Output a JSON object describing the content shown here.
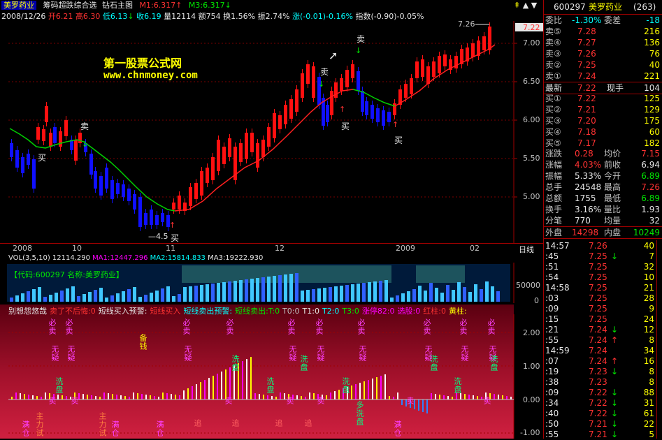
{
  "header": {
    "stock_name": "美罗药业",
    "formula": "筹码超跌综合选",
    "indicator": "钻石主图",
    "m1": "M1:6.317",
    "m3": "M3:6.317",
    "date": "2008/12/26",
    "open": "开6.21",
    "high": "高6.30",
    "low": "低6.13",
    "close": "收6.19",
    "volume": "量12114",
    "amount": "额754",
    "turnover": "换1.56%",
    "amplitude": "振2.74%",
    "change": "涨(-0.01)-0.16%",
    "index": "指数(-0.90)-0.05%",
    "watermark_title": "第一股票公式网",
    "watermark_url": "www.chnmoney.com"
  },
  "price_axis": {
    "labels": [
      "7.00",
      "6.50",
      "6.00",
      "5.50",
      "5.00"
    ],
    "current": "7.22",
    "top": "7.26"
  },
  "date_axis": {
    "labels": [
      "2008",
      "10",
      "11",
      "12",
      "2009",
      "02"
    ],
    "mode": "日线"
  },
  "price_marks": {
    "buy": "买",
    "sell": "卖",
    "low_note": "4.5"
  },
  "volume": {
    "header": "VOL(3,5,10) 12114.290",
    "ma1": "MA1:12447.296",
    "ma2": "MA2:15814.833",
    "ma3": "MA3:19222.930",
    "box": "【代码:600297 名称:美罗药业】",
    "axis": [
      "50000",
      "0"
    ]
  },
  "indicator": {
    "items": [
      {
        "text": "别想怨悠哉",
        "color": "#e6e6e6"
      },
      {
        "text": "卖了不后悔:0",
        "color": "#ff3232"
      },
      {
        "text": "短线买入预警:",
        "color": "#e6e6e6"
      },
      {
        "text": "短线买入",
        "color": "#ff3232"
      },
      {
        "text": "短线卖出预警:",
        "color": "#00ffff"
      },
      {
        "text": "短线卖出:T:0",
        "color": "#00e600"
      },
      {
        "text": "T0:0",
        "color": "#c0c0c0"
      },
      {
        "text": "T1:0",
        "color": "#e6e6e6"
      },
      {
        "text": "T2:0",
        "color": "#00ffff"
      },
      {
        "text": "T3:0",
        "color": "#00e600"
      },
      {
        "text": "涨停82:0",
        "color": "#ff00ff"
      },
      {
        "text": "选股:0",
        "color": "#ff00ff"
      },
      {
        "text": "红柱:0",
        "color": "#ff3232"
      },
      {
        "text": "黄柱:",
        "color": "#ffff00"
      }
    ],
    "axis": [
      "2.00",
      "1.00",
      "0.00",
      "-1.00"
    ],
    "sell_must": "必卖",
    "no_doubt": "无疑",
    "wash": "洗盘",
    "chase": "追",
    "sell": "卖",
    "main_test": "主力试",
    "full_pos": "满仓",
    "more_wash": "多洗盘",
    "prepare": "备钱"
  },
  "quote": {
    "code": "600297",
    "name": "美罗药业",
    "count": "(263)",
    "weibi_label": "委比",
    "weibi": "-1.30%",
    "weicha_label": "委差",
    "weicha": "-18",
    "sells": [
      {
        "label": "卖⑤",
        "price": "7.28",
        "vol": "216"
      },
      {
        "label": "卖④",
        "price": "7.27",
        "vol": "136"
      },
      {
        "label": "卖③",
        "price": "7.26",
        "vol": "76"
      },
      {
        "label": "卖②",
        "price": "7.25",
        "vol": "40"
      },
      {
        "label": "卖①",
        "price": "7.24",
        "vol": "221"
      }
    ],
    "latest_label": "最新",
    "latest": "7.22",
    "hand_label": "现手",
    "hand": "104",
    "buys": [
      {
        "label": "买①",
        "price": "7.22",
        "vol": "125"
      },
      {
        "label": "买②",
        "price": "7.21",
        "vol": "129"
      },
      {
        "label": "买③",
        "price": "7.20",
        "vol": "175"
      },
      {
        "label": "买④",
        "price": "7.18",
        "vol": "60"
      },
      {
        "label": "买⑤",
        "price": "7.17",
        "vol": "182"
      }
    ],
    "stats": [
      {
        "l1": "涨跌",
        "v1": "0.28",
        "c1": "#ff3232",
        "l2": "均价",
        "v2": "7.15",
        "c2": "#ff3232"
      },
      {
        "l1": "涨幅",
        "v1": "4.03%",
        "c1": "#ff3232",
        "l2": "前收",
        "v2": "6.94",
        "c2": "#e6e6e6"
      },
      {
        "l1": "振幅",
        "v1": "5.33%",
        "c1": "#e6e6e6",
        "l2": "今开",
        "v2": "6.89",
        "c2": "#00e600"
      },
      {
        "l1": "总手",
        "v1": "24548",
        "c1": "#e6e6e6",
        "l2": "最高",
        "v2": "7.26",
        "c2": "#ff3232"
      },
      {
        "l1": "总额",
        "v1": "1755",
        "c1": "#e6e6e6",
        "l2": "最低",
        "v2": "6.89",
        "c2": "#00e600"
      },
      {
        "l1": "换手",
        "v1": "3.16%",
        "c1": "#e6e6e6",
        "l2": "量比",
        "v2": "1.93",
        "c2": "#e6e6e6"
      },
      {
        "l1": "分笔",
        "v1": "770",
        "c1": "#e6e6e6",
        "l2": "均量",
        "v2": "32",
        "c2": "#e6e6e6"
      }
    ],
    "outer_label": "外盘",
    "outer": "14298",
    "inner_label": "内盘",
    "inner": "10249",
    "ticks": [
      {
        "t": "14:57",
        "p": "7.26",
        "a": "",
        "v": "40",
        "c": "#ff3232"
      },
      {
        "t": ":45",
        "p": "7.25",
        "a": "↓",
        "v": "7",
        "c": "#00e600"
      },
      {
        "t": ":51",
        "p": "7.25",
        "a": "",
        "v": "32",
        "c": "#ff3232"
      },
      {
        "t": ":54",
        "p": "7.25",
        "a": "",
        "v": "10",
        "c": "#ff3232"
      },
      {
        "t": "14:58",
        "p": "7.25",
        "a": "",
        "v": "21",
        "c": "#ff3232"
      },
      {
        "t": ":03",
        "p": "7.25",
        "a": "",
        "v": "28",
        "c": "#ff3232"
      },
      {
        "t": ":09",
        "p": "7.25",
        "a": "",
        "v": "9",
        "c": "#ff3232"
      },
      {
        "t": ":15",
        "p": "7.25",
        "a": "",
        "v": "24",
        "c": "#ff3232"
      },
      {
        "t": ":21",
        "p": "7.24",
        "a": "↓",
        "v": "12",
        "c": "#00e600"
      },
      {
        "t": ":55",
        "p": "7.24",
        "a": "↑",
        "v": "8",
        "c": "#ff3232"
      },
      {
        "t": "14:59",
        "p": "7.24",
        "a": "",
        "v": "34",
        "c": "#ff3232"
      },
      {
        "t": ":07",
        "p": "7.24",
        "a": "↑",
        "v": "16",
        "c": "#ff3232"
      },
      {
        "t": ":19",
        "p": "7.23",
        "a": "↓",
        "v": "8",
        "c": "#00e600"
      },
      {
        "t": ":38",
        "p": "7.23",
        "a": "",
        "v": "8",
        "c": "#ff3232"
      },
      {
        "t": ":09",
        "p": "7.22",
        "a": "↓",
        "v": "88",
        "c": "#00e600"
      },
      {
        "t": ":34",
        "p": "7.22",
        "a": "↓",
        "v": "31",
        "c": "#00e600"
      },
      {
        "t": ":40",
        "p": "7.22",
        "a": "↓",
        "v": "61",
        "c": "#00e600"
      },
      {
        "t": ":50",
        "p": "7.21",
        "a": "↓",
        "v": "22",
        "c": "#00e600"
      },
      {
        "t": ":55",
        "p": "7.21",
        "a": "↓",
        "v": "5",
        "c": "#00e600"
      }
    ]
  }
}
